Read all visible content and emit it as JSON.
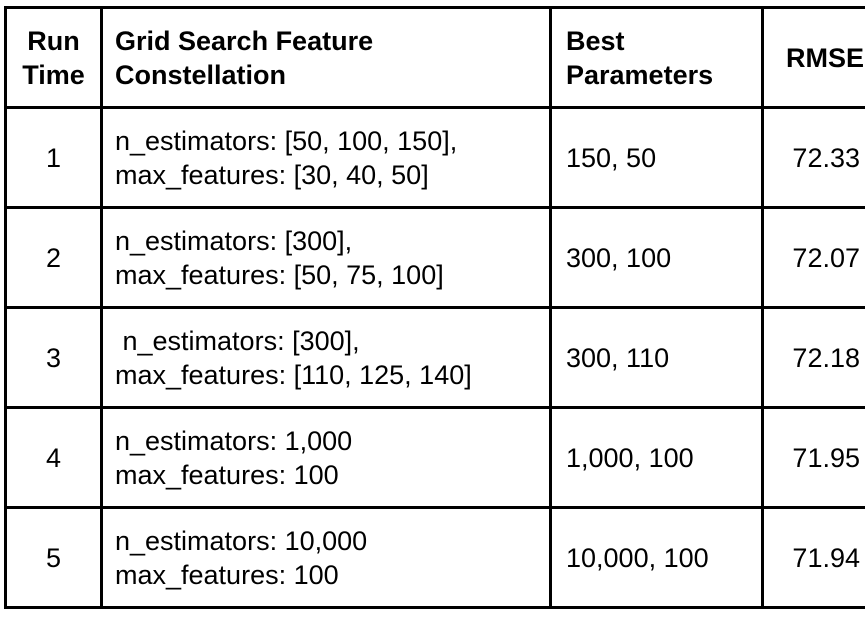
{
  "headers": {
    "run_time": [
      "Run",
      "Time"
    ],
    "grid_search": [
      "Grid Search Feature",
      "Constellation"
    ],
    "best_parameters": [
      "Best",
      "Parameters"
    ],
    "rmse": "RMSE"
  },
  "rows": [
    {
      "run": "1",
      "grid": [
        "n_estimators: [50, 100, 150],",
        "max_features: [30, 40, 50]"
      ],
      "best": "150, 50",
      "rmse": "72.33"
    },
    {
      "run": "2",
      "grid": [
        "n_estimators: [300],",
        "max_features: [50, 75, 100]"
      ],
      "best": "300, 100",
      "rmse": "72.07"
    },
    {
      "run": "3",
      "grid": [
        " n_estimators: [300],",
        "max_features: [110, 125, 140]"
      ],
      "best": "300, 110",
      "rmse": "72.18"
    },
    {
      "run": "4",
      "grid": [
        "n_estimators: 1,000",
        "max_features: 100"
      ],
      "best": "1,000, 100",
      "rmse": "71.95"
    },
    {
      "run": "5",
      "grid": [
        "n_estimators: 10,000",
        "max_features: 100"
      ],
      "best": "10,000, 100",
      "rmse": "71.94"
    }
  ]
}
